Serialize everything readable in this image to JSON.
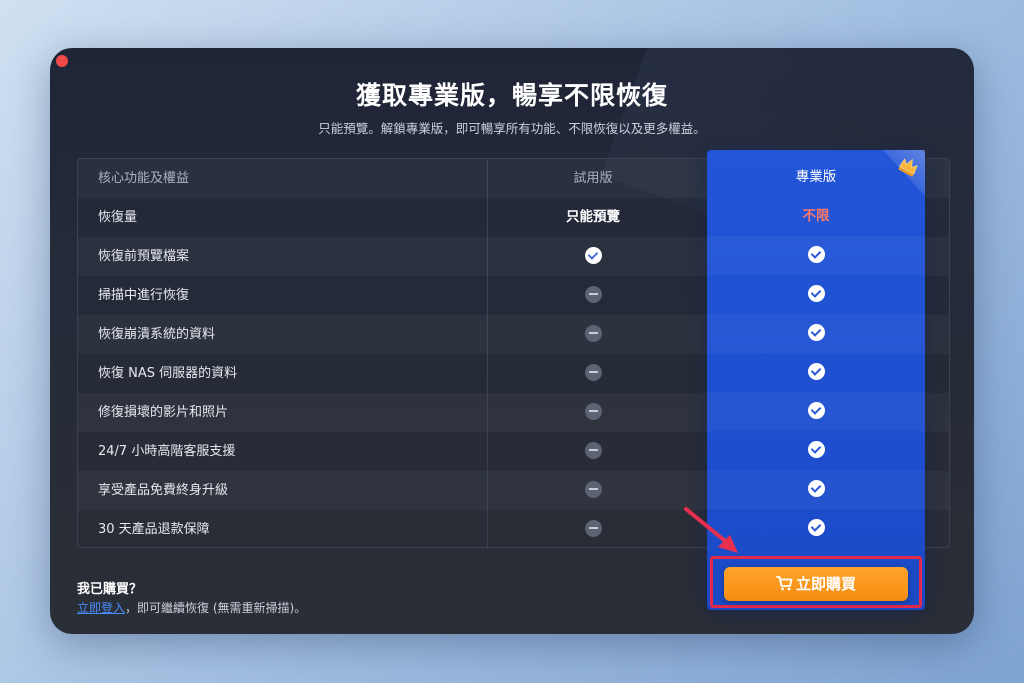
{
  "dialog": {
    "title": "獲取專業版，暢享不限恢復",
    "subtitle": "只能預覽。解鎖專業版，即可暢享所有功能、不限恢復以及更多權益。"
  },
  "table": {
    "headers": {
      "feature": "核心功能及權益",
      "trial": "試用版",
      "pro": "專業版"
    },
    "rows": [
      {
        "feature": "恢復量",
        "trial": "只能預覽",
        "trial_icon": "",
        "pro": "不限",
        "pro_icon": ""
      },
      {
        "feature": "恢復前預覽檔案",
        "trial": "",
        "trial_icon": "check-icon",
        "pro": "",
        "pro_icon": "check-icon"
      },
      {
        "feature": "掃描中進行恢復",
        "trial": "",
        "trial_icon": "dash-icon",
        "pro": "",
        "pro_icon": "check-icon"
      },
      {
        "feature": "恢復崩潰系統的資料",
        "trial": "",
        "trial_icon": "dash-icon",
        "pro": "",
        "pro_icon": "check-icon"
      },
      {
        "feature": "恢復 NAS 伺服器的資料",
        "trial": "",
        "trial_icon": "dash-icon",
        "pro": "",
        "pro_icon": "check-icon"
      },
      {
        "feature": "修復損壞的影片和照片",
        "trial": "",
        "trial_icon": "dash-icon",
        "pro": "",
        "pro_icon": "check-icon"
      },
      {
        "feature": "24/7 小時高階客服支援",
        "trial": "",
        "trial_icon": "dash-icon",
        "pro": "",
        "pro_icon": "check-icon"
      },
      {
        "feature": "享受產品免費終身升級",
        "trial": "",
        "trial_icon": "dash-icon",
        "pro": "",
        "pro_icon": "check-icon"
      },
      {
        "feature": "30 天產品退款保障",
        "trial": "",
        "trial_icon": "dash-icon",
        "pro": "",
        "pro_icon": "check-icon"
      }
    ]
  },
  "footer": {
    "purchased_label": "我已購買？",
    "login_link": "立即登入",
    "login_rest": "，即可繼續恢復 (無需重新掃描)。",
    "buy_button": "立即購買"
  },
  "colors": {
    "pro_column": "#2255d8",
    "unlimited_text": "#ff7b67",
    "buy_button": "#f7941d",
    "highlight_frame": "#e42a4a",
    "close_dot": "#ef4a4a"
  },
  "icons": [
    "close-dot-icon",
    "crown-icon",
    "check-icon",
    "dash-icon",
    "cart-icon",
    "arrow-annotation"
  ]
}
